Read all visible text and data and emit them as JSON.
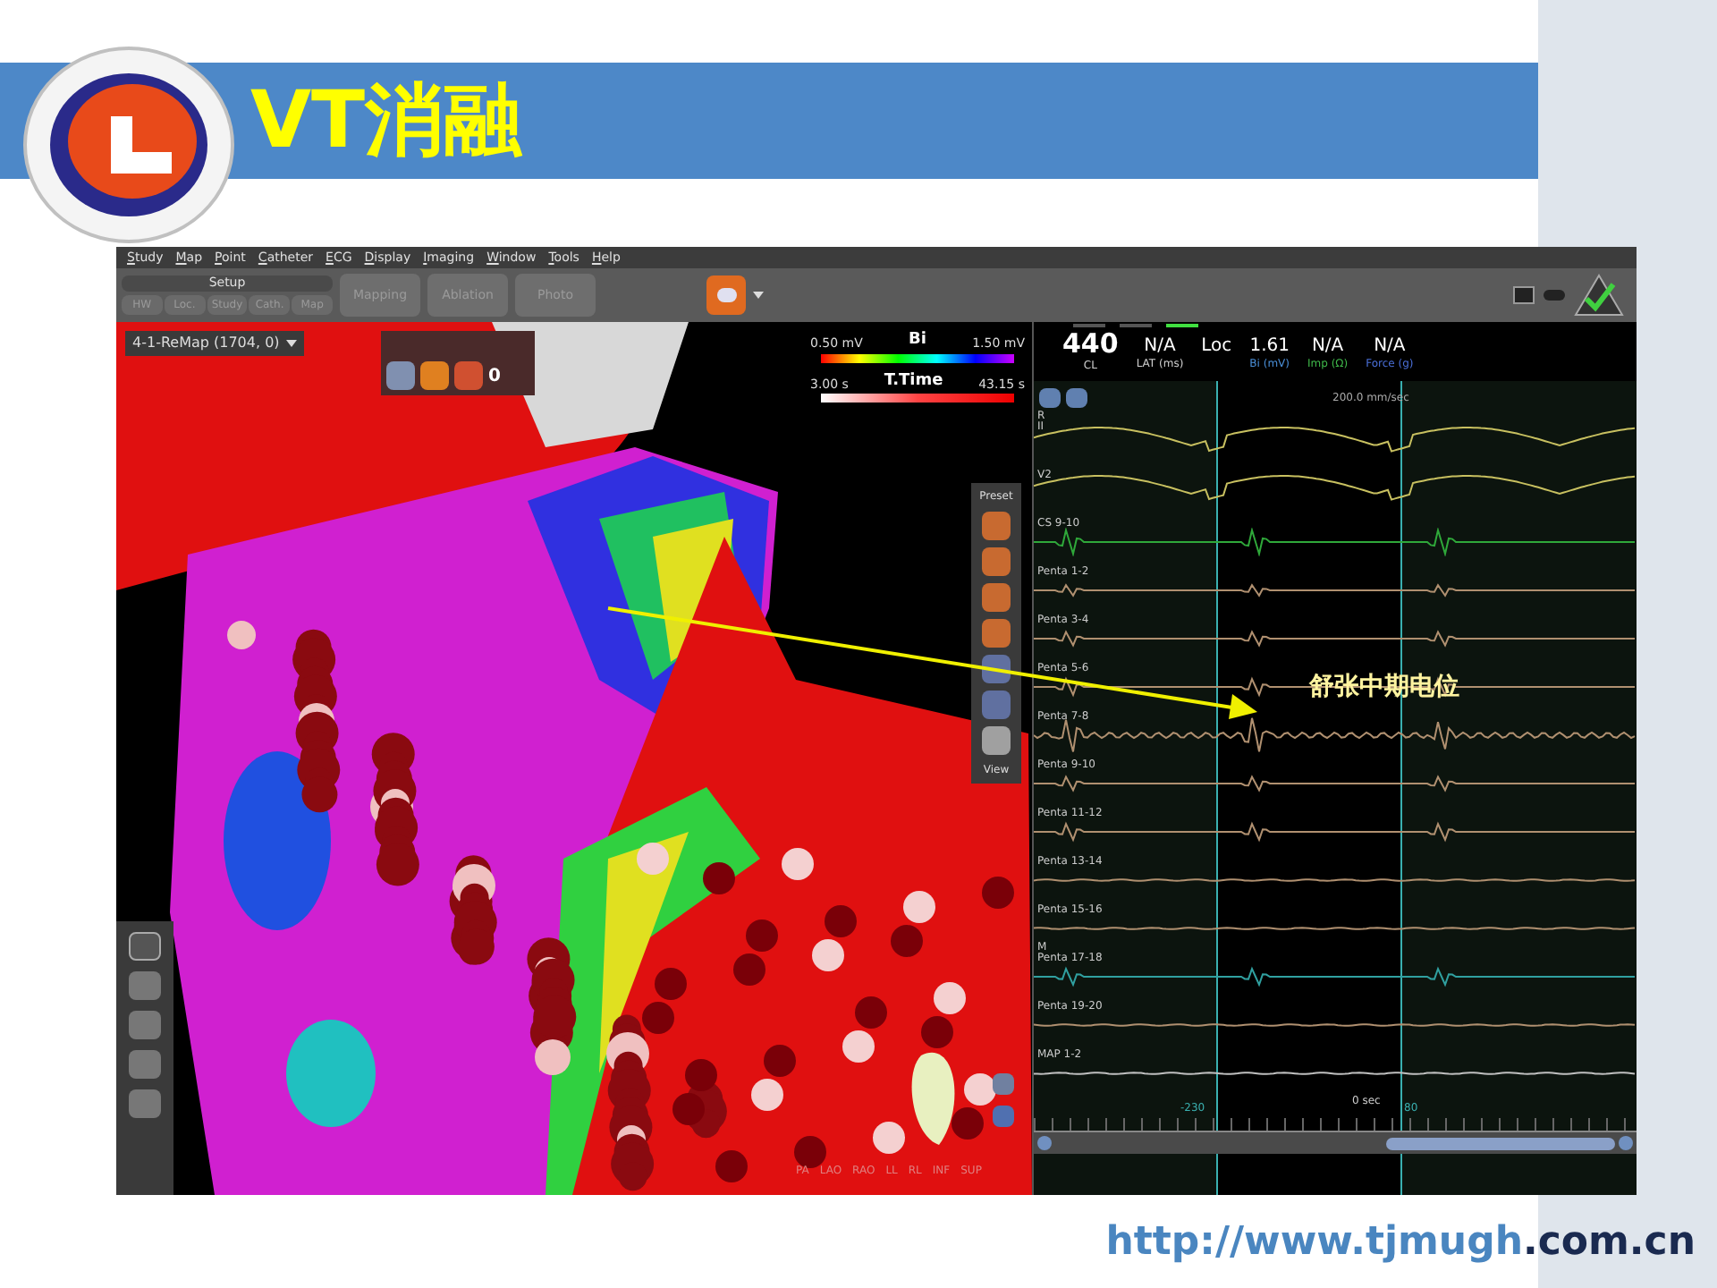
{
  "slide": {
    "title": "VT消融",
    "url": {
      "host": "http://www.tjmugh",
      "domain": ".com.cn"
    }
  },
  "app": {
    "menu": [
      "Study",
      "Map",
      "Point",
      "Catheter",
      "ECG",
      "Display",
      "Imaging",
      "Window",
      "Tools",
      "Help"
    ],
    "setup": {
      "label": "Setup",
      "tabs": [
        {
          "label": "HW",
          "disabled": true
        },
        {
          "label": "Loc.",
          "disabled": true
        },
        {
          "label": "Study",
          "disabled": true
        },
        {
          "label": "Cath.",
          "disabled": true
        },
        {
          "label": "Map",
          "disabled": true
        }
      ]
    },
    "modes": [
      {
        "label": "Mapping",
        "disabled": true
      },
      {
        "label": "Ablation",
        "disabled": true
      },
      {
        "label": "Photo",
        "disabled": true
      }
    ]
  },
  "map_panel": {
    "map_selector": "4-1-ReMap (1704, 0)",
    "widget_count": "0",
    "legends": [
      {
        "min": "0.50 mV",
        "label": "Bi",
        "max": "1.50 mV",
        "kind": "rainbow"
      },
      {
        "min": "3.00 s",
        "label": "T.Time",
        "max": "43.15 s",
        "kind": "red"
      }
    ],
    "tool_labels": {
      "top": "Preset",
      "bottom": "View"
    },
    "orientations": [
      "PA",
      "LAO",
      "RAO",
      "LL",
      "RL",
      "INF",
      "SUP"
    ]
  },
  "annotation": {
    "text": "舒张中期电位"
  },
  "ecg_panel": {
    "indicators": [
      {
        "on": false
      },
      {
        "on": false
      },
      {
        "on": true
      }
    ],
    "readings": [
      {
        "value": "440",
        "label": "CL",
        "color": "#d0d0d0",
        "kind": "big"
      },
      {
        "value": "N/A",
        "label": "LAT (ms)",
        "color": "#d0d0d0",
        "kind": "normal"
      },
      {
        "value": "Loc",
        "kind": "normal"
      },
      {
        "value": "1.61",
        "label": "Bi (mV)",
        "color": "#4a8fd8",
        "kind": "normal"
      },
      {
        "value": "N/A",
        "label": "Imp (Ω)",
        "color": "#3fb84a",
        "kind": "normal"
      },
      {
        "value": "N/A",
        "label": "Force (g)",
        "color": "#4a6fd8",
        "kind": "normal"
      }
    ],
    "sweep": "200.0 mm/sec",
    "channels": [
      {
        "name": "II",
        "group": "R",
        "color": "#c8c060",
        "kind": "surface"
      },
      {
        "name": "V2",
        "color": "#c8c060",
        "kind": "surface"
      },
      {
        "name": "CS 9-10",
        "color": "#2fa83a",
        "kind": "cs"
      },
      {
        "name": "Penta 1-2",
        "color": "#b09070",
        "kind": "bipolar"
      },
      {
        "name": "Penta 3-4",
        "color": "#b09070",
        "kind": "bipolar"
      },
      {
        "name": "Penta 5-6",
        "color": "#b09070",
        "kind": "bipolar"
      },
      {
        "name": "Penta 7-8",
        "color": "#b09070",
        "kind": "fractionated"
      },
      {
        "name": "Penta 9-10",
        "color": "#b09070",
        "kind": "bipolar"
      },
      {
        "name": "Penta 11-12",
        "color": "#b09070",
        "kind": "bipolar"
      },
      {
        "name": "Penta 13-14",
        "color": "#b09070",
        "kind": "flat"
      },
      {
        "name": "Penta 15-16",
        "color": "#b09070",
        "kind": "flat"
      },
      {
        "name": "Penta 17-18",
        "group": "M",
        "color": "#30a0a0",
        "kind": "bipolar"
      },
      {
        "name": "Penta 19-20",
        "color": "#b09070",
        "kind": "flat"
      },
      {
        "name": "MAP 1-2",
        "color": "#c0c0c0",
        "kind": "flat"
      }
    ],
    "time_labels": {
      "start": "-230",
      "zero": "0 sec",
      "end": "80"
    }
  }
}
